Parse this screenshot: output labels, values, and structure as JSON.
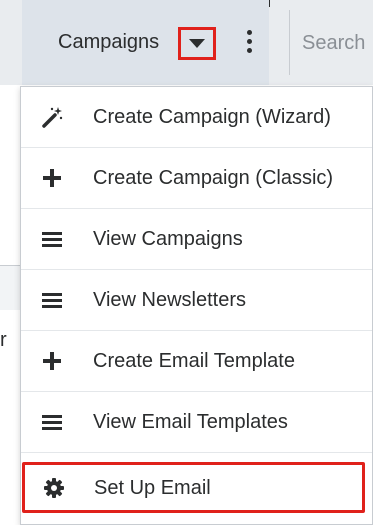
{
  "nav": {
    "module_label": "Campaigns",
    "search_placeholder": "Search"
  },
  "background": {
    "partial_char": "r"
  },
  "menu": {
    "items": [
      {
        "label": "Create Campaign (Wizard)",
        "icon": "magic-wand-icon"
      },
      {
        "label": "Create Campaign (Classic)",
        "icon": "plus-icon"
      },
      {
        "label": "View Campaigns",
        "icon": "list-icon"
      },
      {
        "label": "View Newsletters",
        "icon": "list-icon"
      },
      {
        "label": "Create Email Template",
        "icon": "plus-icon"
      },
      {
        "label": "View Email Templates",
        "icon": "list-icon"
      },
      {
        "label": "Set Up Email",
        "icon": "gear-icon",
        "highlighted": true
      }
    ]
  },
  "colors": {
    "highlight": "#e0211b",
    "nav_background": "#e9ecef",
    "tab_background": "#dde3ea",
    "text": "#2b2d2e"
  }
}
